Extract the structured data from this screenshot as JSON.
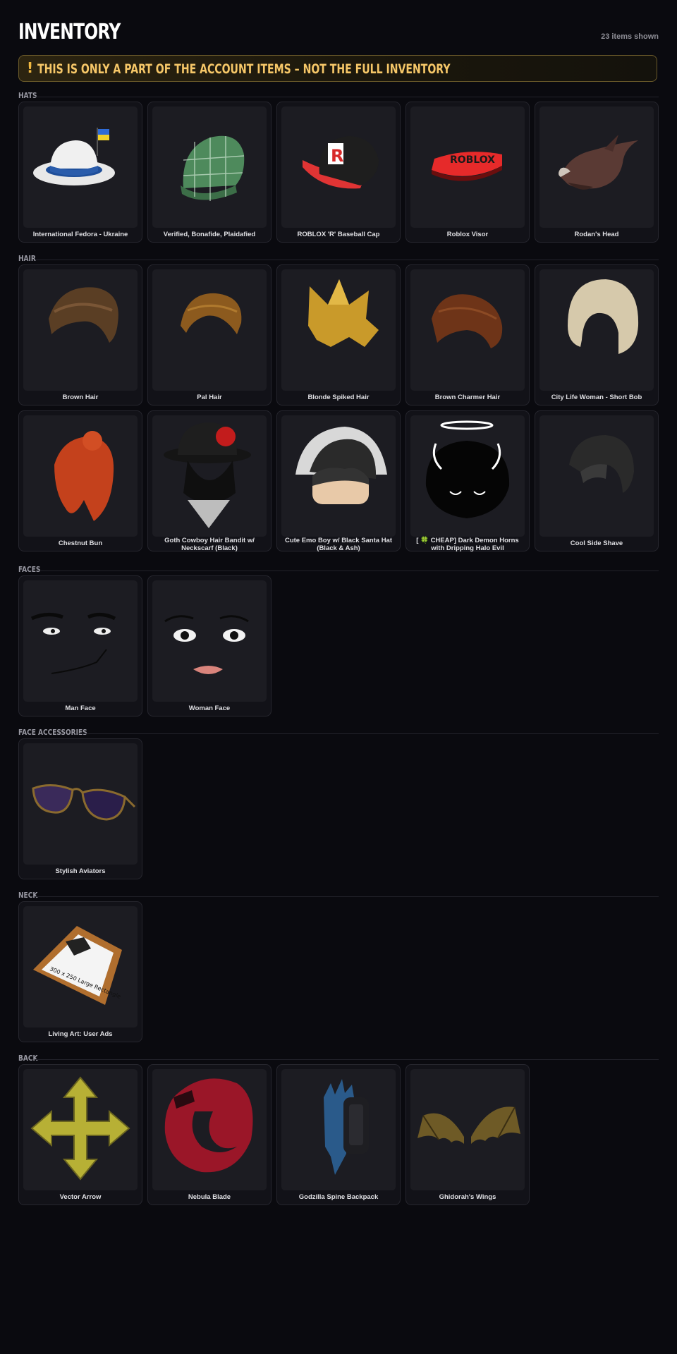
{
  "header": {
    "title": "INVENTORY",
    "count": "23 items shown"
  },
  "banner": {
    "icon": "!",
    "text": "THIS IS ONLY A PART OF THE ACCOUNT ITEMS – NOT THE FULL INVENTORY"
  },
  "sections": {
    "hats": {
      "label": "HATS",
      "items": [
        {
          "name": "International Fedora - Ukraine",
          "icon": "fedora-icon"
        },
        {
          "name": "Verified, Bonafide, Plaidafied",
          "icon": "plaid-cap-icon"
        },
        {
          "name": "ROBLOX 'R' Baseball Cap",
          "icon": "baseball-cap-icon"
        },
        {
          "name": "Roblox Visor",
          "icon": "visor-icon"
        },
        {
          "name": "Rodan's Head",
          "icon": "dragon-head-icon"
        }
      ]
    },
    "hair": {
      "label": "HAIR",
      "items": [
        {
          "name": "Brown Hair",
          "icon": "brown-hair-icon"
        },
        {
          "name": "Pal Hair",
          "icon": "pal-hair-icon"
        },
        {
          "name": "Blonde Spiked Hair",
          "icon": "blonde-spiked-hair-icon"
        },
        {
          "name": "Brown Charmer Hair",
          "icon": "brown-charmer-hair-icon"
        },
        {
          "name": "City Life Woman - Short Bob",
          "icon": "short-bob-icon"
        },
        {
          "name": "Chestnut Bun",
          "icon": "chestnut-bun-icon"
        },
        {
          "name": "Goth Cowboy Hair Bandit w/ Neckscarf (Black)",
          "icon": "goth-cowboy-icon"
        },
        {
          "name": "Cute Emo Boy w/ Black Santa Hat (Black & Ash)",
          "icon": "emo-boy-icon"
        },
        {
          "name": "[ 🍀 CHEAP] Dark Demon Horns with Dripping Halo Evil",
          "icon": "demon-horns-icon"
        },
        {
          "name": "Cool Side Shave",
          "icon": "side-shave-icon"
        }
      ]
    },
    "faces": {
      "label": "FACES",
      "items": [
        {
          "name": "Man Face",
          "icon": "man-face-icon"
        },
        {
          "name": "Woman Face",
          "icon": "woman-face-icon"
        }
      ]
    },
    "face_accessories": {
      "label": "FACE ACCESSORIES",
      "items": [
        {
          "name": "Stylish Aviators",
          "icon": "aviators-icon"
        }
      ]
    },
    "neck": {
      "label": "NECK",
      "items": [
        {
          "name": "Living Art: User Ads",
          "icon": "framed-art-icon",
          "art_text": "300 x 250 Large Rectangle"
        }
      ]
    },
    "back": {
      "label": "BACK",
      "items": [
        {
          "name": "Vector Arrow",
          "icon": "vector-arrow-icon"
        },
        {
          "name": "Nebula Blade",
          "icon": "nebula-blade-icon"
        },
        {
          "name": "Godzilla Spine Backpack",
          "icon": "spine-backpack-icon"
        },
        {
          "name": "Ghidorah's Wings",
          "icon": "wings-icon"
        }
      ]
    }
  }
}
